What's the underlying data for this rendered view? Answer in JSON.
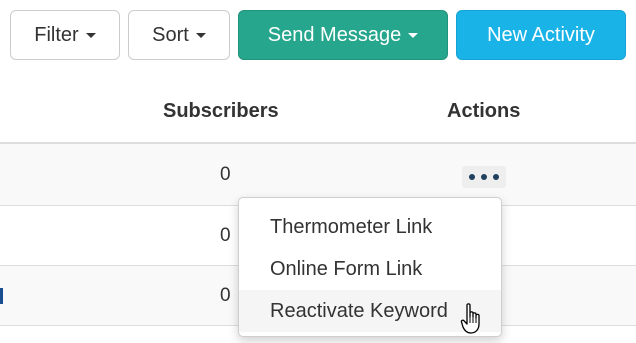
{
  "toolbar": {
    "filter_label": "Filter",
    "sort_label": "Sort",
    "send_message_label": "Send Message",
    "new_activity_label": "New Activity"
  },
  "table": {
    "columns": [
      "Subscribers",
      "Actions"
    ],
    "rows": [
      {
        "subscribers": "0"
      },
      {
        "subscribers": "0"
      },
      {
        "subscribers": "0"
      }
    ]
  },
  "actions_menu": {
    "items": [
      "Thermometer Link",
      "Online Form Link",
      "Reactivate Keyword"
    ],
    "hovered": "Reactivate Keyword"
  },
  "colors": {
    "send_message_bg": "#26a68c",
    "new_activity_bg": "#1ab3e8",
    "row_stripe": "#f9f9f9",
    "border": "#dddddd"
  },
  "icons": {
    "caret": "chevron-down-icon",
    "actions": "more-horizontal-icon",
    "cursor": "hand-pointer-icon"
  }
}
